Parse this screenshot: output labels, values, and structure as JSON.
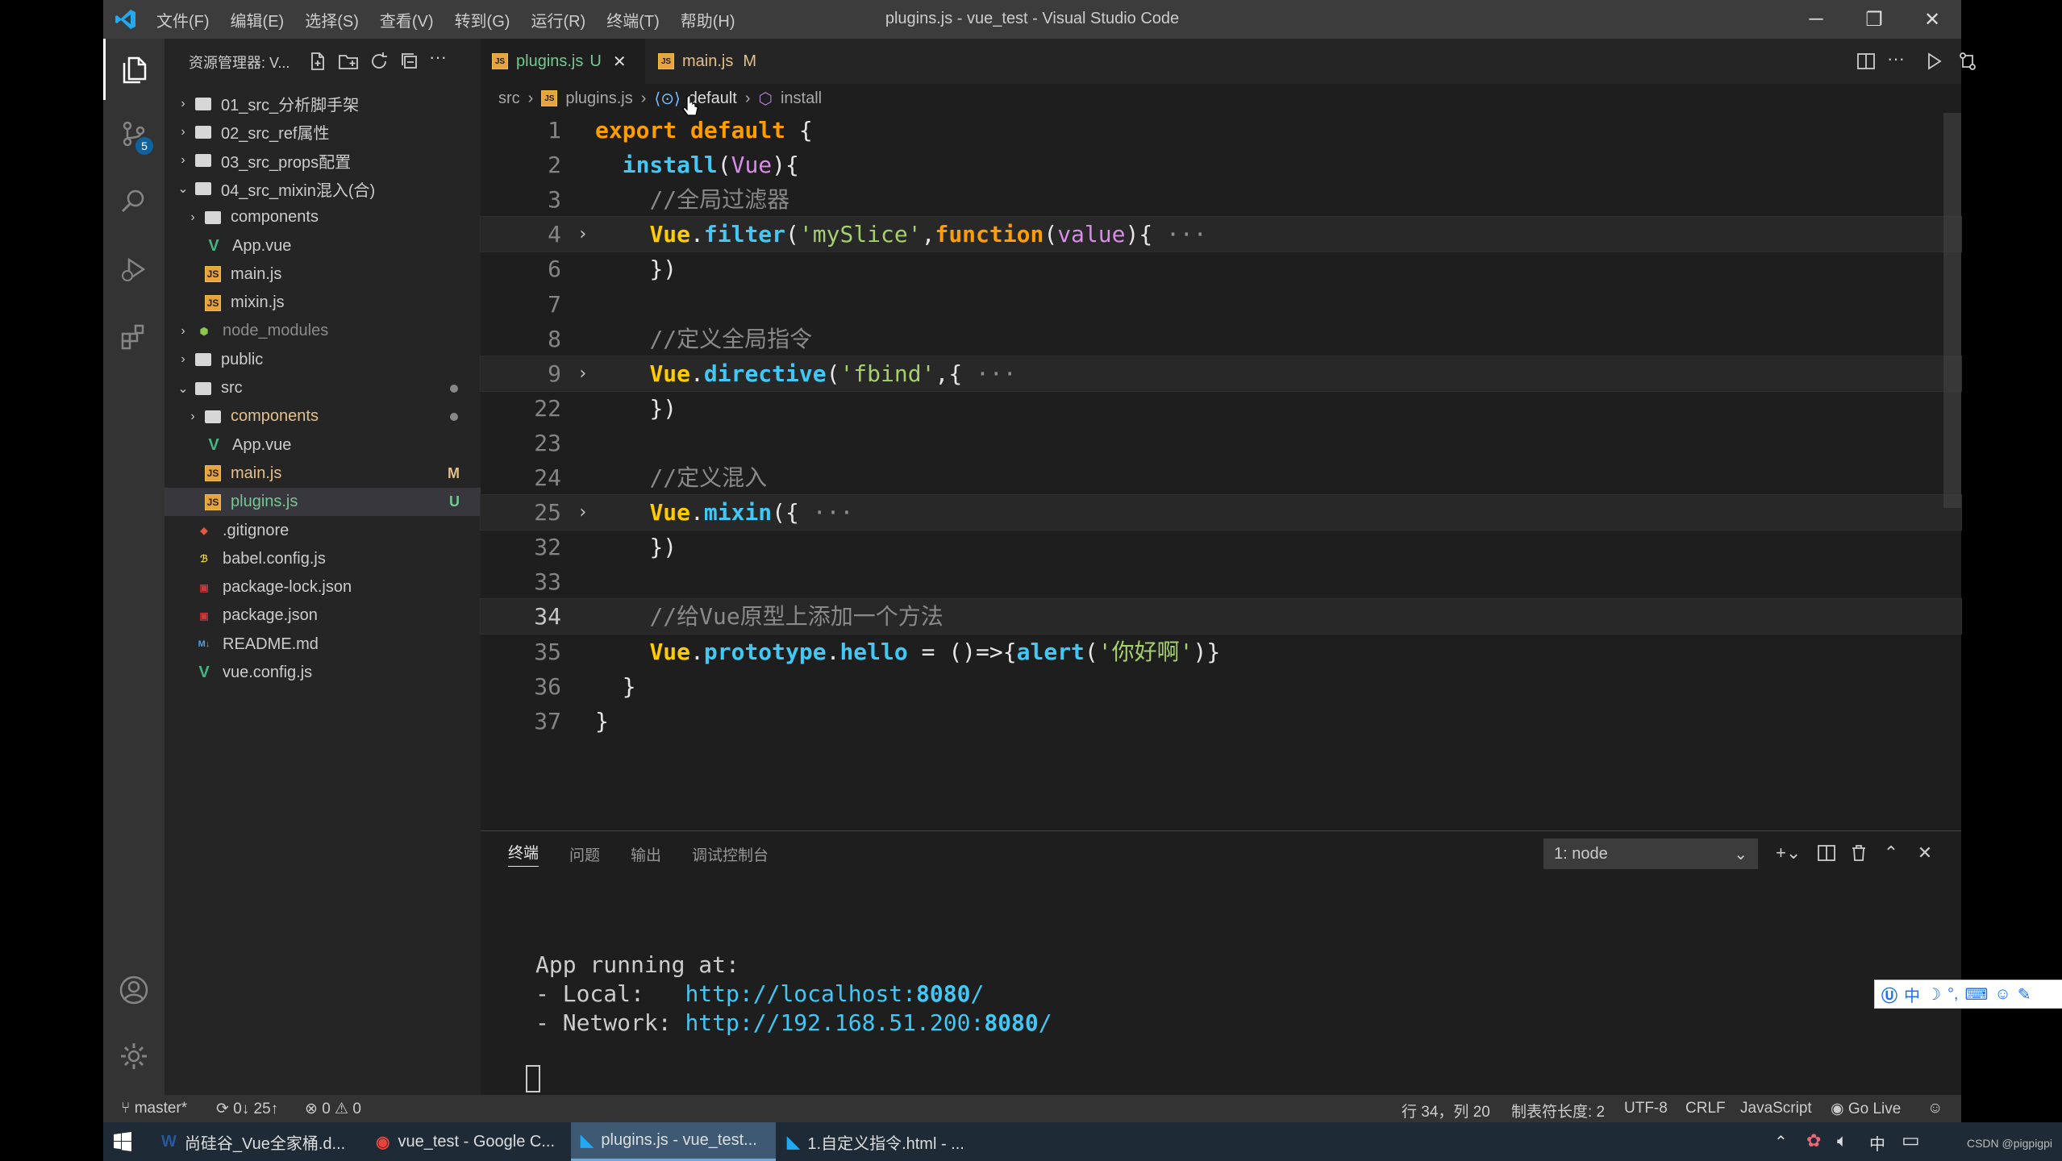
{
  "window": {
    "title": "plugins.js - vue_test - Visual Studio Code",
    "menu": [
      "文件(F)",
      "编辑(E)",
      "选择(S)",
      "查看(V)",
      "转到(G)",
      "运行(R)",
      "终端(T)",
      "帮助(H)"
    ]
  },
  "activity": {
    "scm_badge": "5"
  },
  "sidebar": {
    "title": "资源管理器: V...",
    "tree": [
      {
        "label": "01_src_分析脚手架",
        "indent": 0,
        "kind": "folder",
        "chev": "›"
      },
      {
        "label": "02_src_ref属性",
        "indent": 0,
        "kind": "folder",
        "chev": "›"
      },
      {
        "label": "03_src_props配置",
        "indent": 0,
        "kind": "folder",
        "chev": "›"
      },
      {
        "label": "04_src_mixin混入(合)",
        "indent": 0,
        "kind": "folder",
        "chev": "⌄"
      },
      {
        "label": "components",
        "indent": 1,
        "kind": "folder",
        "chev": "›"
      },
      {
        "label": "App.vue",
        "indent": 1,
        "kind": "vue"
      },
      {
        "label": "main.js",
        "indent": 1,
        "kind": "js"
      },
      {
        "label": "mixin.js",
        "indent": 1,
        "kind": "js"
      },
      {
        "label": "node_modules",
        "indent": 0,
        "kind": "node",
        "chev": "›"
      },
      {
        "label": "public",
        "indent": 0,
        "kind": "folder",
        "chev": "›"
      },
      {
        "label": "src",
        "indent": 0,
        "kind": "folder",
        "chev": "⌄",
        "dot": true,
        "color": "#ccc"
      },
      {
        "label": "components",
        "indent": 1,
        "kind": "folder",
        "chev": "›",
        "dot": true,
        "color": "#e2c08d"
      },
      {
        "label": "App.vue",
        "indent": 1,
        "kind": "vue"
      },
      {
        "label": "main.js",
        "indent": 1,
        "kind": "js",
        "status": "M",
        "color": "#e2c08d"
      },
      {
        "label": "plugins.js",
        "indent": 1,
        "kind": "js",
        "status": "U",
        "color": "#73c991",
        "selected": true
      },
      {
        "label": ".gitignore",
        "indent": 0,
        "kind": "git"
      },
      {
        "label": "babel.config.js",
        "indent": 0,
        "kind": "babel"
      },
      {
        "label": "package-lock.json",
        "indent": 0,
        "kind": "npm"
      },
      {
        "label": "package.json",
        "indent": 0,
        "kind": "npm"
      },
      {
        "label": "README.md",
        "indent": 0,
        "kind": "md"
      },
      {
        "label": "vue.config.js",
        "indent": 0,
        "kind": "vue"
      }
    ]
  },
  "tabs": [
    {
      "label": "plugins.js",
      "status": "U",
      "active": true
    },
    {
      "label": "main.js",
      "status": "M",
      "active": false
    }
  ],
  "breadcrumb": [
    "src",
    "plugins.js",
    "default",
    "install"
  ],
  "editor": {
    "current_line": "34",
    "lines": [
      {
        "n": "1",
        "html": "<span class='kw'>export</span> <span class='kw'>default</span> <span class='pun'>{</span>"
      },
      {
        "n": "2",
        "html": "  <span class='fn'>install</span><span class='pun'>(</span><span class='par'>Vue</span><span class='pun'>){</span>"
      },
      {
        "n": "3",
        "html": "    <span class='com'>//全局过滤器</span>"
      },
      {
        "n": "4",
        "fold": true,
        "hl": true,
        "html": "    <span class='obj'>Vue</span><span class='pun'>.</span><span class='fn'>filter</span><span class='pun'>(</span><span class='str'>'mySlice'</span><span class='pun'>,</span><span class='kw'>function</span><span class='pun'>(</span><span class='par'>value</span><span class='pun'>){</span> <span class='ell'>···</span>"
      },
      {
        "n": "6",
        "html": "    <span class='pun'>})</span>"
      },
      {
        "n": "7",
        "html": ""
      },
      {
        "n": "8",
        "html": "    <span class='com'>//定义全局指令</span>"
      },
      {
        "n": "9",
        "fold": true,
        "hl": true,
        "html": "    <span class='obj'>Vue</span><span class='pun'>.</span><span class='fn'>directive</span><span class='pun'>(</span><span class='str'>'fbind'</span><span class='pun'>,{</span> <span class='ell'>···</span>"
      },
      {
        "n": "22",
        "html": "    <span class='pun'>})</span>"
      },
      {
        "n": "23",
        "html": ""
      },
      {
        "n": "24",
        "html": "    <span class='com'>//定义混入</span>"
      },
      {
        "n": "25",
        "fold": true,
        "hl": true,
        "html": "    <span class='obj'>Vue</span><span class='pun'>.</span><span class='fn'>mixin</span><span class='pun'>({</span> <span class='ell'>···</span>"
      },
      {
        "n": "32",
        "html": "    <span class='pun'>})</span>"
      },
      {
        "n": "33",
        "html": ""
      },
      {
        "n": "34",
        "hl": true,
        "html": "    <span class='com'>//给Vue原型上添加一个方法</span>"
      },
      {
        "n": "35",
        "html": "    <span class='obj'>Vue</span><span class='pun'>.</span><span class='fn'>prototype</span><span class='pun'>.</span><span class='fn'>hello</span> <span class='pun'>=</span> <span class='pun'>()=>{</span><span class='fn'>alert</span><span class='pun'>(</span><span class='str'>'你好啊'</span><span class='pun'>)}</span>"
      },
      {
        "n": "36",
        "html": "  <span class='pun'>}</span>"
      },
      {
        "n": "37",
        "html": "<span class='pun'>}</span>"
      }
    ]
  },
  "panel": {
    "tabs": [
      "终端",
      "问题",
      "输出",
      "调试控制台"
    ],
    "terminal_select": "1: node",
    "output": {
      "line1": "App running at:",
      "local_label": "- Local:   ",
      "local_url": "http://localhost:",
      "local_port": "8080",
      "local_tail": "/",
      "net_label": "- Network: ",
      "net_url": "http://192.168.51.200:",
      "net_port": "8080",
      "net_tail": "/"
    }
  },
  "status": {
    "branch": "master*",
    "sync": "0↓ 25↑",
    "errors": "0",
    "warnings": "0",
    "position": "行 34，列 20",
    "tab_size": "制表符长度: 2",
    "encoding": "UTF-8",
    "eol": "CRLF",
    "language": "JavaScript",
    "golive": "Go Live"
  },
  "taskbar": [
    {
      "label": "尚硅谷_Vue全家桶.d...",
      "icon": "word-icon"
    },
    {
      "label": "vue_test - Google C...",
      "icon": "chrome-icon"
    },
    {
      "label": "plugins.js - vue_test...",
      "icon": "vscode-icon",
      "active": true
    },
    {
      "label": "1.自定义指令.html - ...",
      "icon": "vscode-icon"
    }
  ],
  "tray": {
    "ime": "中"
  },
  "watermark": "CSDN @pigpigpi",
  "colors": {
    "accent": "#0e639c",
    "modified": "#e2c08d",
    "untracked": "#73c991"
  }
}
